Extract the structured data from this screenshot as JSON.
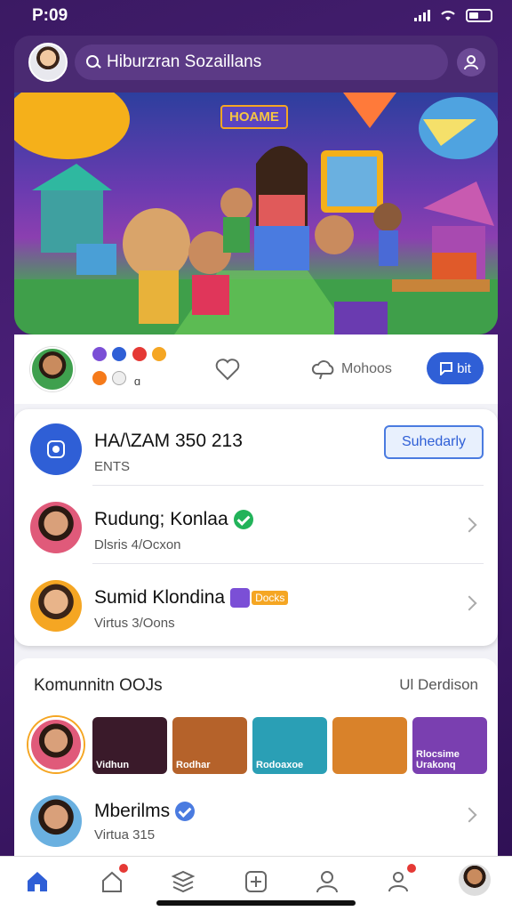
{
  "status": {
    "time": "P:09"
  },
  "header": {
    "search_text": "Hiburzran Sozaillans"
  },
  "hero": {
    "title": "HOAME"
  },
  "post": {
    "reaction_count": "ɑ",
    "more_label": "Mohoos",
    "bit_label": "bit"
  },
  "panel": {
    "items": [
      {
        "title": "HA/\\ZAM 350 213",
        "subtitle": "ENTS",
        "action": "Suhedarly"
      },
      {
        "title": "Rudung; Konlaa",
        "subtitle": "Dlsris 4/Ocxon"
      },
      {
        "title": "Sumid Klondina",
        "subtitle": "Virtus 3/Oons",
        "tag": "Docks"
      }
    ]
  },
  "community": {
    "title": "Komunnitn OOJs",
    "link": "Ul Derdison",
    "thumbs": [
      {
        "label": "Vidhun",
        "color": "#3a1a2a"
      },
      {
        "label": "Rodhar",
        "color": "#b5622a"
      },
      {
        "label": "Rodoaxoe",
        "color": "#2a9fb5"
      },
      {
        "label": "",
        "color": "#d9822a"
      },
      {
        "label": "Rlocsime Urakonq",
        "color": "#7a3fb0"
      }
    ],
    "bottom": {
      "title": "Mberilms",
      "subtitle": "Virtua 315"
    }
  },
  "colors": {
    "accent": "#2f5fd6",
    "background": "#4a1f78"
  },
  "icons": [
    "search-icon",
    "user-icon",
    "heart-icon",
    "cloud-icon",
    "home-icon",
    "house-icon",
    "layers-icon",
    "plus-icon",
    "profile-icon",
    "group-icon"
  ]
}
